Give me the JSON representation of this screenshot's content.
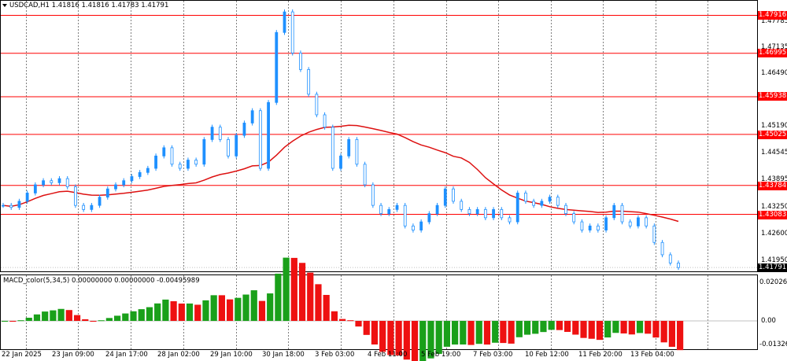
{
  "symbol_info": "USDCAD,H1  1.41816 1.41816 1.41783 1.41791",
  "macd_title": "MACD_color(5,34,5) 0.00000000 0.00000000 -0.00495989",
  "colors": {
    "level_line": "#ff0000",
    "ma_line": "#dd1111",
    "candle": "#1e90ff",
    "macd_up": "#1aa01a",
    "macd_down": "#ee1111",
    "grid": "#7f7f7f"
  },
  "price_axis": {
    "ticks": [
      "1.47785",
      "1.47135",
      "1.46490",
      "1.45840",
      "1.45190",
      "1.44545",
      "1.43895",
      "1.43250",
      "1.42600",
      "1.41950"
    ]
  },
  "levels": [
    "1.47916",
    "1.46995",
    "1.45938",
    "1.45025",
    "1.43784",
    "1.43083"
  ],
  "current_price": "1.41791",
  "macd_axis": {
    "top": "0.0202662",
    "zero": "0.00",
    "bottom": "-0.0132619"
  },
  "time_axis": [
    "22 Jan 2025",
    "23 Jan 09:00",
    "24 Jan 17:00",
    "28 Jan 02:00",
    "29 Jan 10:00",
    "30 Jan 18:00",
    "3 Feb 03:00",
    "4 Feb 11:00",
    "5 Feb 19:00",
    "7 Feb 03:00",
    "10 Feb 12:00",
    "11 Feb 20:00",
    "13 Feb 04:00"
  ],
  "chart_data": {
    "type": "line",
    "series": [
      {
        "values": [
          1.433,
          1.4325,
          1.434,
          1.436,
          1.438,
          1.439,
          1.4385,
          1.4395,
          1.4375,
          1.433,
          1.432,
          1.433,
          1.435,
          1.437,
          1.438,
          1.439,
          1.44,
          1.441,
          1.442,
          1.445,
          1.447,
          1.443,
          1.442,
          1.444,
          1.443,
          1.449,
          1.452,
          1.449,
          1.445,
          1.45,
          1.453,
          1.456,
          1.442,
          1.458,
          1.475,
          1.48,
          1.47,
          1.466,
          1.46,
          1.455,
          1.452,
          1.442,
          1.445,
          1.449,
          1.443,
          1.438,
          1.433,
          1.431,
          1.432,
          1.433,
          1.428,
          1.427,
          1.429,
          1.431,
          1.433,
          1.437,
          1.434,
          1.432,
          1.431,
          1.432,
          1.43,
          1.432,
          1.43,
          1.429,
          1.436,
          1.434,
          1.433,
          1.434,
          1.435,
          1.433,
          1.431,
          1.429,
          1.427,
          1.428,
          1.427,
          1.43,
          1.433,
          1.429,
          1.428,
          1.43,
          1.428,
          1.424,
          1.421,
          1.419,
          1.4179
        ]
      }
    ]
  }
}
